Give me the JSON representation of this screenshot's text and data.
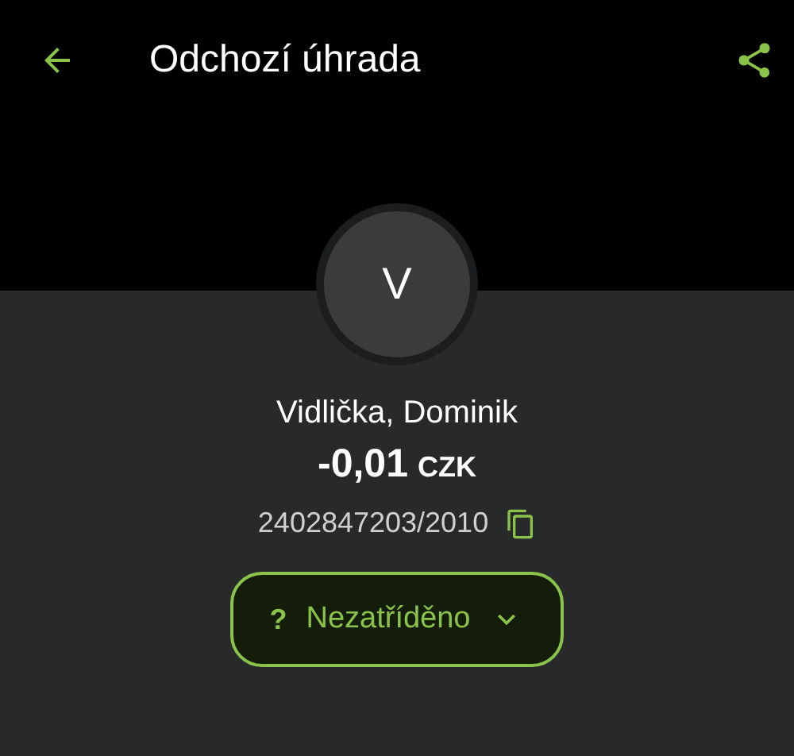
{
  "app_bar": {
    "title": "Odchozí úhrada"
  },
  "counterparty": {
    "initial": "V",
    "name": "Vidlička, Dominik",
    "amount": "-0,01",
    "currency": "CZK",
    "account": "2402847203/2010"
  },
  "category": {
    "icon": "?",
    "label": "Nezatříděno",
    "expanded": false
  }
}
